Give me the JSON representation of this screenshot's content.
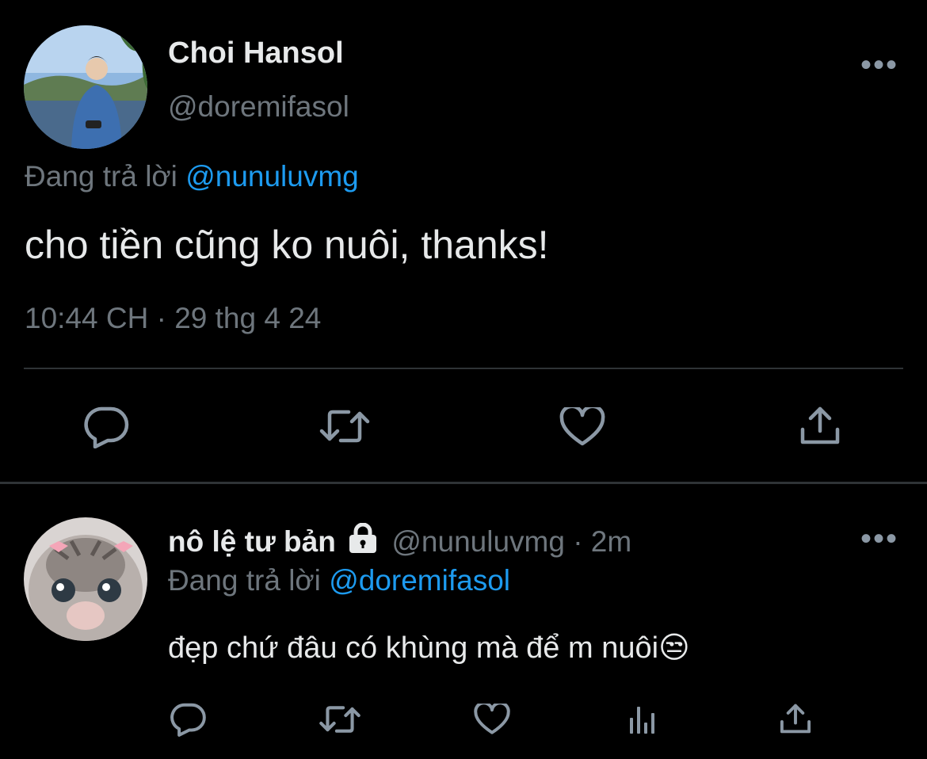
{
  "main_tweet": {
    "display_name": "Choi Hansol",
    "handle": "@doremifasol",
    "replying_to_label": "Đang trả lời",
    "replying_to_handle": "@nunuluvmg",
    "text": "cho tiền cũng ko nuôi, thanks!",
    "timestamp": "10:44 CH · 29 thg 4 24",
    "more_icon": "more-horizontal-icon",
    "actions": [
      "reply-icon",
      "retweet-icon",
      "like-icon",
      "share-icon"
    ]
  },
  "reply_tweet": {
    "display_name": "nô lệ tư bản",
    "lock_icon": "lock-icon",
    "handle_time": "@nunuluvmg · 2m",
    "replying_to_label": "Đang trả lời",
    "replying_to_handle": "@doremifasol",
    "text": "đẹp chứ đâu có khùng mà để m nuôi",
    "emoji": "😒",
    "more_icon": "more-horizontal-icon",
    "actions": [
      "reply-icon",
      "retweet-icon",
      "like-icon",
      "analytics-icon",
      "share-icon"
    ]
  },
  "colors": {
    "background": "#000000",
    "text": "#e7e9ea",
    "muted": "#6e767d",
    "link": "#1d9bf0",
    "divider": "#2f3336"
  }
}
